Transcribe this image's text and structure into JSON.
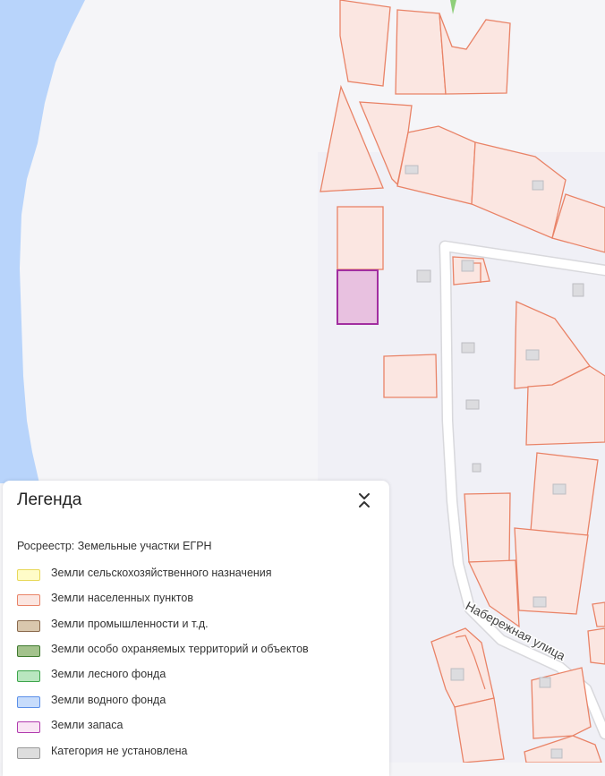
{
  "map": {
    "street_label": "Набережная улица",
    "water_color": "#b8d4fb",
    "parcel_fill": "#fbe6e1",
    "parcel_stroke": "#e98367",
    "selected_fill": "#e8c1e0",
    "selected_stroke": "#a22ea0"
  },
  "legend": {
    "title": "Легенда",
    "subtitle": "Росреестр: Земельные участки ЕГРН",
    "items": [
      {
        "label": "Земли сельскохозяйственного назначения",
        "fill": "#fffcc8",
        "stroke": "#e8d85a"
      },
      {
        "label": "Земли населенных пунктов",
        "fill": "#fbe6e1",
        "stroke": "#e98367"
      },
      {
        "label": "Земли промышленности и т.д.",
        "fill": "#d9c7ad",
        "stroke": "#8a6a4d"
      },
      {
        "label": "Земли особо охраняемых территорий и объектов",
        "fill": "#a3c28c",
        "stroke": "#3f7a2f"
      },
      {
        "label": "Земли лесного фонда",
        "fill": "#b9e6bf",
        "stroke": "#3da54b"
      },
      {
        "label": "Земли водного фонда",
        "fill": "#c7dcfb",
        "stroke": "#5b8fe8"
      },
      {
        "label": "Земли запаса",
        "fill": "#f9e4f4",
        "stroke": "#b03aae"
      },
      {
        "label": "Категория не установлена",
        "fill": "#dddddd",
        "stroke": "#9a9a9a"
      }
    ]
  }
}
